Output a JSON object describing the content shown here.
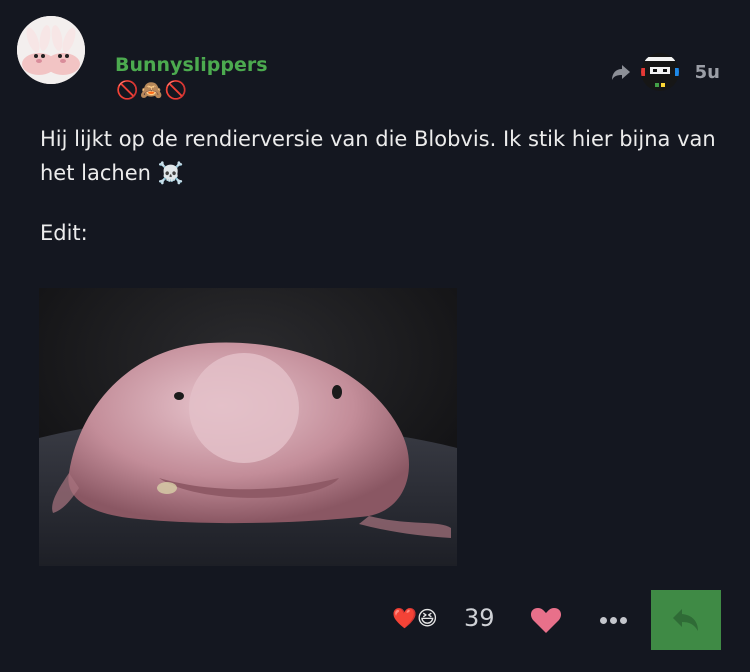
{
  "post": {
    "username": "Bunnyslippers",
    "flair": [
      "🚫",
      "🙈",
      "🚫"
    ],
    "age": "5u",
    "body_line1": "Hij lijkt op de rendierversie van die Blobvis. Ik stik hier bijna van het lachen ☠️",
    "body_line2": "Edit:",
    "reactions": [
      "❤️",
      "😆"
    ],
    "reaction_count": "39"
  },
  "icons": {
    "reply_to": "share-arrow-icon",
    "like": "heart-icon",
    "more": "ellipsis-icon",
    "reply": "reply-icon"
  },
  "colors": {
    "background": "#141720",
    "username": "#4caa4f",
    "reply_button": "#3f8a45",
    "like_heart": "#e8708a"
  }
}
